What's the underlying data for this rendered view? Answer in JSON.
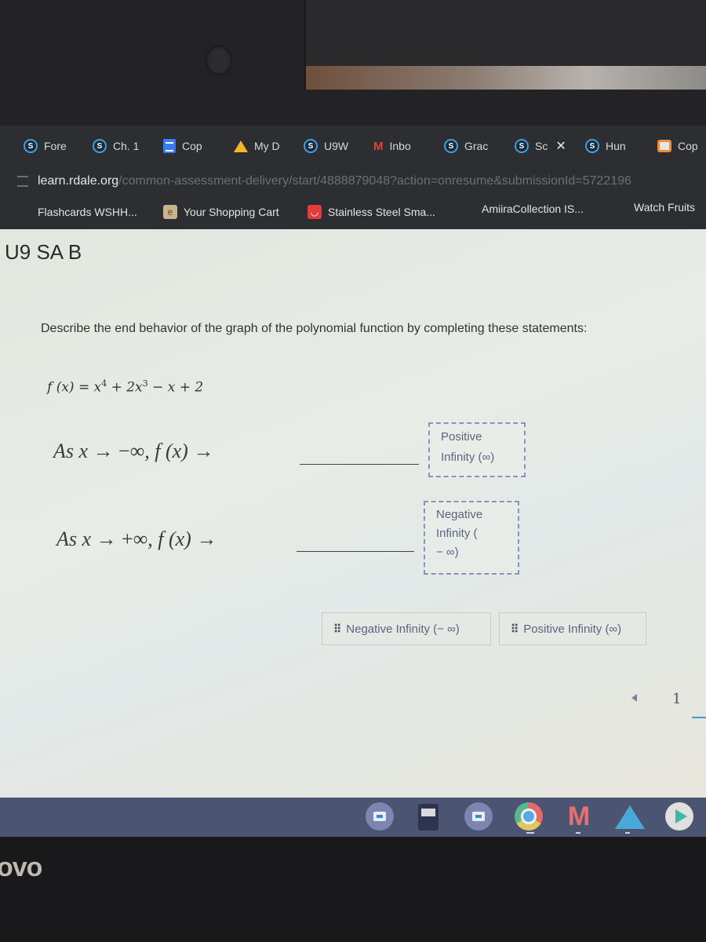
{
  "browser": {
    "tabs": [
      {
        "label": "Fore",
        "icon": "schoology-icon"
      },
      {
        "label": "Ch. 1",
        "icon": "schoology-icon"
      },
      {
        "label": "Cop",
        "icon": "docs-icon"
      },
      {
        "label": "My D",
        "icon": "drive-icon"
      },
      {
        "label": "U9W",
        "icon": "schoology-icon"
      },
      {
        "label": "Inbo",
        "icon": "gmail-icon"
      },
      {
        "label": "Grac",
        "icon": "schoology-icon"
      },
      {
        "label": "Sc",
        "icon": "schoology-icon",
        "active": true
      },
      {
        "label": "Hun",
        "icon": "schoology-icon"
      },
      {
        "label": "Cop",
        "icon": "slides-icon"
      }
    ],
    "close_glyph": "✕",
    "url_host": "learn.rdale.org",
    "url_path": "/common-assessment-delivery/start/4888879048?action=onresume&submissionId=5722196",
    "bookmarks": [
      {
        "label": "Flashcards WSHH..."
      },
      {
        "label": "Your Shopping Cart",
        "icon": "cart-site-icon"
      },
      {
        "label": "Stainless Steel Sma...",
        "icon": "steel-site-icon"
      },
      {
        "label": "AmiiraCollection IS..."
      },
      {
        "label": "Watch Fruits"
      }
    ]
  },
  "assessment": {
    "title": "U9 SA B",
    "prompt": "Describe the end behavior of the graph of the polynomial function by completing these statements:",
    "function_lhs": "f (x) = x",
    "function_parts": [
      "4",
      " + 2x",
      "3",
      " − x + 2"
    ],
    "statements": [
      {
        "prefix": "As x",
        "arrow": " → ",
        "limit": "−∞",
        "suffix": ", f (x) →",
        "answer_line1": "Positive",
        "answer_line2": "Infinity (∞)",
        "answer_line3": ""
      },
      {
        "prefix": "As x",
        "arrow": " → ",
        "limit": "+∞",
        "suffix": ", f (x) →",
        "answer_line1": "Negative",
        "answer_line2": "Infinity (",
        "answer_line3": "− ∞)"
      }
    ],
    "choices": [
      {
        "label": "Negative Infinity (− ∞)"
      },
      {
        "label": "Positive Infinity (∞)"
      }
    ],
    "grip_glyph": "⠿",
    "page_number": "1"
  },
  "shelf": {
    "apps": [
      "camera-app",
      "calculator-app",
      "camera-app",
      "chrome-app",
      "gmail-app",
      "drive-app",
      "play-store-app"
    ],
    "gmail_glyph": "M"
  },
  "device": {
    "logo": "ovo"
  }
}
